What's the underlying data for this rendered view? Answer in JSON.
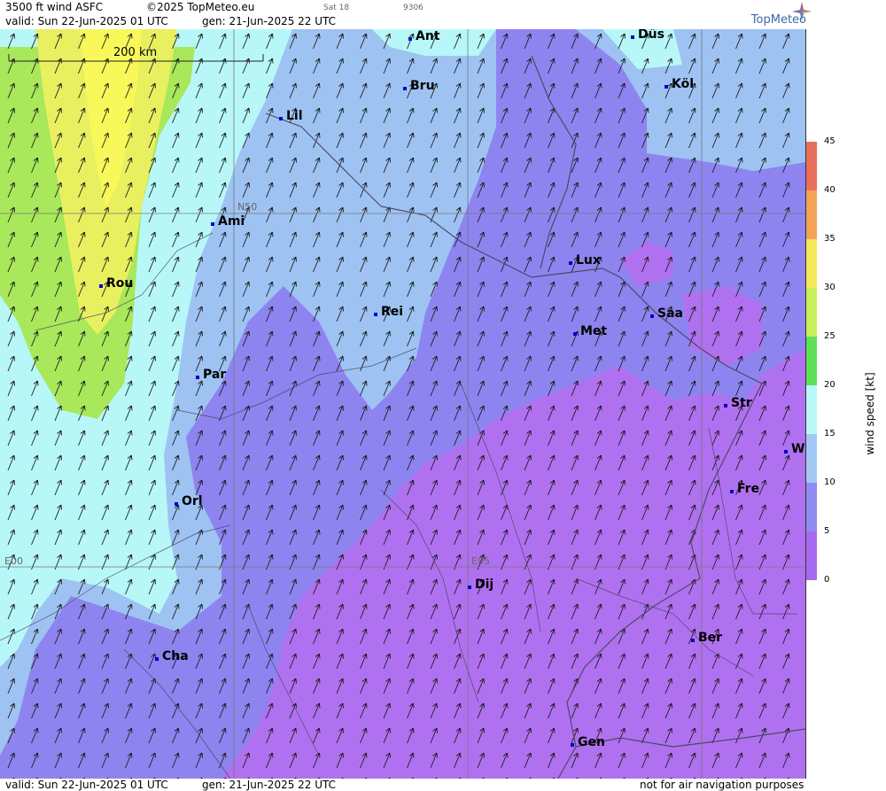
{
  "header": {
    "title": "3500 ft wind ASFC",
    "copyright": "©2025 TopMeteo.eu",
    "run_tag": "Sat 18",
    "code": "9306",
    "valid": "valid:  Sun  22-Jun-2025  01 UTC",
    "generated": "gen: 21-Jun-2025 22 UTC"
  },
  "brand": {
    "name": "TopMeteo"
  },
  "footer": {
    "valid": "valid:  Sun  22-Jun-2025  01 UTC",
    "generated": "gen: 21-Jun-2025 22 UTC",
    "disclaimer": "not for air navigation purposes"
  },
  "scale": {
    "label": "200 km"
  },
  "grid_labels": {
    "lat": "N50",
    "lon0": "E00",
    "lon5": "E05"
  },
  "cities": [
    {
      "name": "Ant"
    },
    {
      "name": "Düs"
    },
    {
      "name": "Bru"
    },
    {
      "name": "Köl"
    },
    {
      "name": "Lil"
    },
    {
      "name": "Ami"
    },
    {
      "name": "Rou"
    },
    {
      "name": "Lux"
    },
    {
      "name": "Rei"
    },
    {
      "name": "Saa"
    },
    {
      "name": "Met"
    },
    {
      "name": "Par"
    },
    {
      "name": "Str"
    },
    {
      "name": "W"
    },
    {
      "name": "Fre"
    },
    {
      "name": "Orl"
    },
    {
      "name": "Dij"
    },
    {
      "name": "Ber"
    },
    {
      "name": "Cha"
    },
    {
      "name": "Gen"
    }
  ],
  "legend": {
    "unit": "wind speed [kt]",
    "ticks": [
      "45",
      "40",
      "35",
      "30",
      "25",
      "20",
      "15",
      "10",
      "5",
      "0"
    ],
    "colors": [
      "#e8705a",
      "#f3a35a",
      "#f5e85a",
      "#c8f05a",
      "#5ee05a",
      "#b8f8f8",
      "#a4c8f4",
      "#8e8cf0",
      "#a86af0"
    ]
  }
}
